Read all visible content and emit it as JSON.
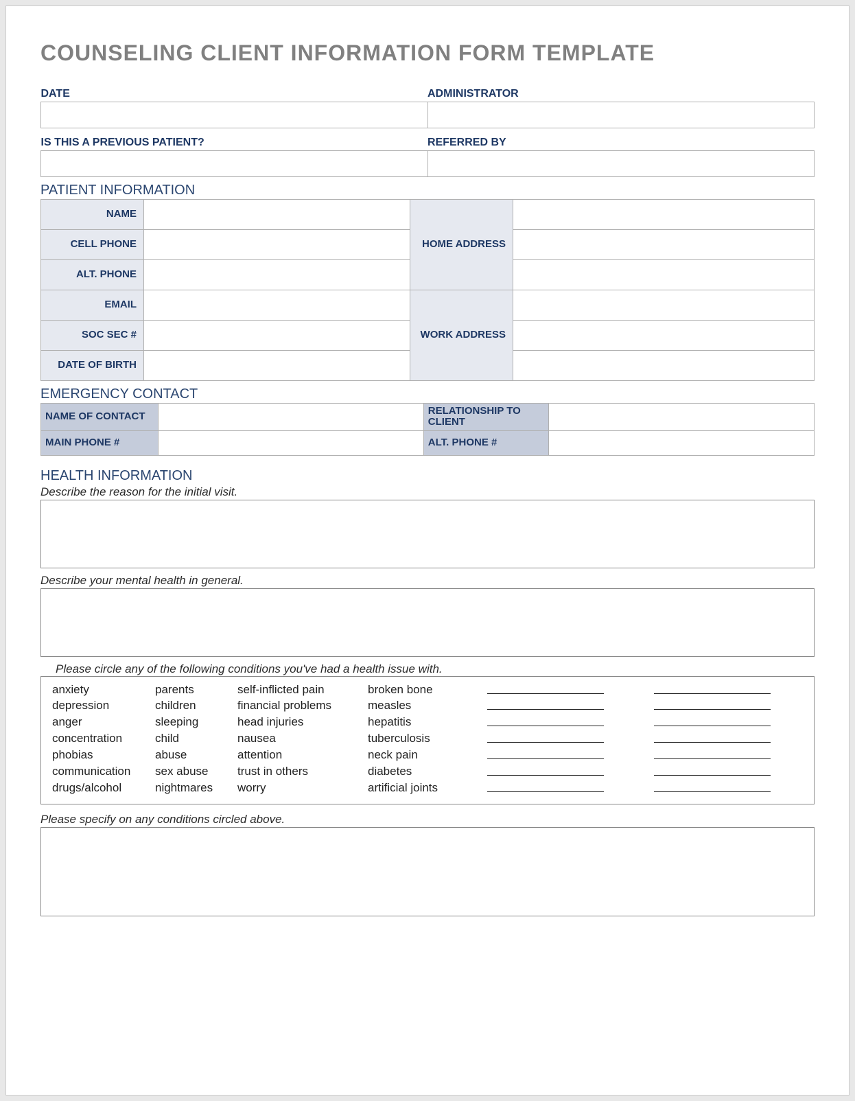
{
  "title": "COUNSELING CLIENT INFORMATION FORM TEMPLATE",
  "header": {
    "date_label": "DATE",
    "date_value": "",
    "admin_label": "ADMINISTRATOR",
    "admin_value": "",
    "prev_label": "IS THIS A PREVIOUS PATIENT?",
    "prev_value": "",
    "ref_label": "REFERRED BY",
    "ref_value": ""
  },
  "patient": {
    "section": "PATIENT INFORMATION",
    "name_label": "NAME",
    "name_value": "",
    "cell_label": "CELL PHONE",
    "cell_value": "",
    "alt_label": "ALT. PHONE",
    "alt_value": "",
    "email_label": "EMAIL",
    "email_value": "",
    "ssn_label": "SOC SEC #",
    "ssn_value": "",
    "dob_label": "DATE OF BIRTH",
    "dob_value": "",
    "home_label": "HOME ADDRESS",
    "home_v1": "",
    "home_v2": "",
    "home_v3": "",
    "work_label": "WORK ADDRESS",
    "work_v1": "",
    "work_v2": "",
    "work_v3": ""
  },
  "emergency": {
    "section": "EMERGENCY CONTACT",
    "name_label": "NAME OF CONTACT",
    "name_value": "",
    "rel_label": "RELATIONSHIP TO CLIENT",
    "rel_value": "",
    "main_label": "MAIN PHONE #",
    "main_value": "",
    "alt_label": "ALT. PHONE #",
    "alt_value": ""
  },
  "health": {
    "section": "HEALTH INFORMATION",
    "reason_prompt": "Describe the reason for the initial visit.",
    "reason_value": "",
    "mental_prompt": "Describe your mental health in general.",
    "mental_value": "",
    "conditions_prompt": "Please circle any of the following conditions you've had a health issue with.",
    "specify_prompt": "Please specify on any conditions circled above.",
    "specify_value": "",
    "conditions": {
      "col_a": [
        "anxiety",
        "depression",
        "anger",
        "concentration",
        "phobias",
        "communication",
        "drugs/alcohol"
      ],
      "col_b": [
        "parents",
        "children",
        "sleeping",
        "child",
        "abuse",
        "sex abuse",
        "nightmares"
      ],
      "col_c": [
        "self-inflicted pain",
        "financial problems",
        "head injuries",
        "nausea",
        "attention",
        "trust in others",
        "worry"
      ],
      "col_d": [
        "broken bone",
        "measles",
        "hepatitis",
        "tuberculosis",
        "neck pain",
        "diabetes",
        "artificial joints"
      ]
    }
  }
}
